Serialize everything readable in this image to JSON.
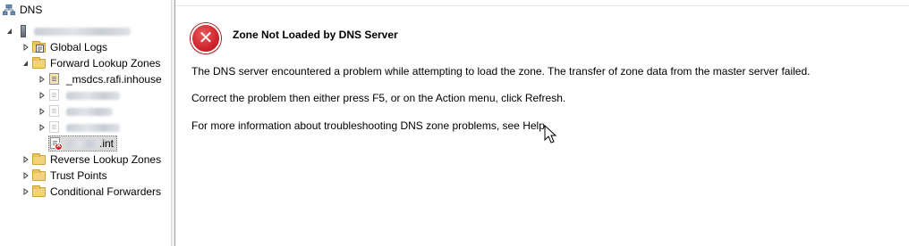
{
  "tree": {
    "root": "DNS",
    "global_logs": "Global Logs",
    "forward_lookup_zones": "Forward Lookup Zones",
    "msdcs_zone": "_msdcs.rafi.inhouse",
    "failed_zone_suffix": ".int",
    "reverse_lookup_zones": "Reverse Lookup Zones",
    "trust_points": "Trust Points",
    "conditional_forwarders": "Conditional Forwarders"
  },
  "main": {
    "title": "Zone Not Loaded by DNS Server",
    "message": "The DNS server encountered a problem while attempting to load the zone. The transfer of zone data from the master server failed.",
    "instruction": "Correct the problem then either press F5, or on the Action menu, click Refresh.",
    "help_text": "For more information about troubleshooting DNS zone problems, see Help."
  },
  "colors": {
    "error_red": "#d8232a",
    "folder_yellow": "#f2d27a",
    "selection_gray": "#d9d9d9"
  }
}
